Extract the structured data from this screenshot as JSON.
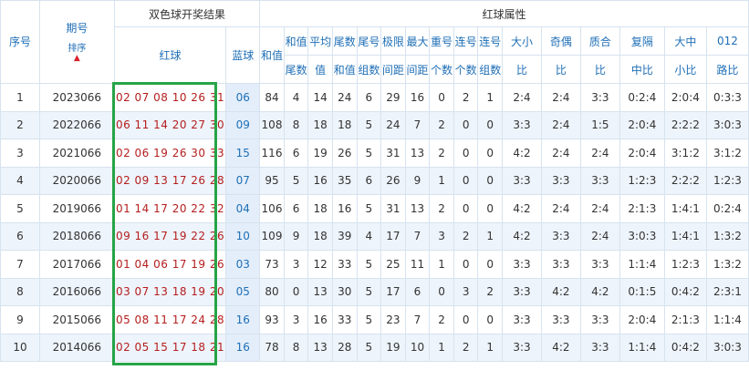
{
  "header": {
    "seq_label": "序号",
    "period_label": "期号",
    "sort_label": "排序",
    "sort_arrow": "▲",
    "draw_results_label": "双色球开奖结果",
    "red_ball_label": "红球",
    "blue_ball_label": "蓝球",
    "red_attr_label": "红球属性",
    "attr_columns": [
      {
        "line1": "和值",
        "line2": ""
      },
      {
        "line1": "和值",
        "line2": "尾数"
      },
      {
        "line1": "平均",
        "line2": "值"
      },
      {
        "line1": "尾数",
        "line2": "和值"
      },
      {
        "line1": "尾号",
        "line2": "组数"
      },
      {
        "line1": "极限",
        "line2": "间距"
      },
      {
        "line1": "最大",
        "line2": "间距"
      },
      {
        "line1": "重号",
        "line2": "个数"
      },
      {
        "line1": "连号",
        "line2": "个数"
      },
      {
        "line1": "连号",
        "line2": "组数"
      },
      {
        "line1": "大小",
        "line2": "比"
      },
      {
        "line1": "奇偶",
        "line2": "比"
      },
      {
        "line1": "质合",
        "line2": "比"
      },
      {
        "line1": "复隔",
        "line2": "中比"
      },
      {
        "line1": "大中",
        "line2": "小比"
      },
      {
        "line1": "012",
        "line2": "路比"
      }
    ]
  },
  "colors": {
    "header_text": "#1f6fb6",
    "red_ball_text": "#b41e1e",
    "highlight_border": "#26a447",
    "alt_row_bg": "#eef4fb"
  },
  "rows": [
    {
      "seq": "1",
      "period": "2023066",
      "red": "02 07 08 10 26 31",
      "blue": "06",
      "attrs": [
        "84",
        "4",
        "14",
        "24",
        "6",
        "29",
        "16",
        "0",
        "2",
        "1",
        "2:4",
        "2:4",
        "3:3",
        "0:2:4",
        "2:0:4",
        "0:3:3"
      ]
    },
    {
      "seq": "2",
      "period": "2022066",
      "red": "06 11 14 20 27 30",
      "blue": "09",
      "attrs": [
        "108",
        "8",
        "18",
        "18",
        "5",
        "24",
        "7",
        "2",
        "0",
        "0",
        "3:3",
        "2:4",
        "1:5",
        "2:0:4",
        "2:2:2",
        "3:0:3"
      ]
    },
    {
      "seq": "3",
      "period": "2021066",
      "red": "02 06 19 26 30 33",
      "blue": "15",
      "attrs": [
        "116",
        "6",
        "19",
        "26",
        "5",
        "31",
        "13",
        "2",
        "0",
        "0",
        "4:2",
        "2:4",
        "2:4",
        "2:0:4",
        "3:1:2",
        "3:1:2"
      ]
    },
    {
      "seq": "4",
      "period": "2020066",
      "red": "02 09 13 17 26 28",
      "blue": "07",
      "attrs": [
        "95",
        "5",
        "16",
        "35",
        "6",
        "26",
        "9",
        "1",
        "0",
        "0",
        "3:3",
        "3:3",
        "3:3",
        "1:2:3",
        "2:2:2",
        "1:2:3"
      ]
    },
    {
      "seq": "5",
      "period": "2019066",
      "red": "01 14 17 20 22 32",
      "blue": "04",
      "attrs": [
        "106",
        "6",
        "18",
        "16",
        "5",
        "31",
        "13",
        "2",
        "0",
        "0",
        "4:2",
        "2:4",
        "2:4",
        "2:1:3",
        "1:4:1",
        "0:2:4"
      ]
    },
    {
      "seq": "6",
      "period": "2018066",
      "red": "09 16 17 19 22 26",
      "blue": "10",
      "attrs": [
        "109",
        "9",
        "18",
        "39",
        "4",
        "17",
        "7",
        "3",
        "2",
        "1",
        "4:2",
        "3:3",
        "2:4",
        "3:0:3",
        "1:4:1",
        "1:3:2"
      ]
    },
    {
      "seq": "7",
      "period": "2017066",
      "red": "01 04 06 17 19 26",
      "blue": "03",
      "attrs": [
        "73",
        "3",
        "12",
        "33",
        "5",
        "25",
        "11",
        "1",
        "0",
        "0",
        "3:3",
        "3:3",
        "3:3",
        "1:1:4",
        "1:2:3",
        "1:3:2"
      ]
    },
    {
      "seq": "8",
      "period": "2016066",
      "red": "03 07 13 18 19 20",
      "blue": "05",
      "attrs": [
        "80",
        "0",
        "13",
        "30",
        "5",
        "17",
        "6",
        "0",
        "3",
        "2",
        "3:3",
        "4:2",
        "4:2",
        "0:1:5",
        "0:4:2",
        "2:3:1"
      ]
    },
    {
      "seq": "9",
      "period": "2015066",
      "red": "05 08 11 17 24 28",
      "blue": "16",
      "attrs": [
        "93",
        "3",
        "16",
        "33",
        "5",
        "23",
        "7",
        "2",
        "0",
        "0",
        "3:3",
        "3:3",
        "3:3",
        "2:0:4",
        "2:1:3",
        "1:1:4"
      ]
    },
    {
      "seq": "10",
      "period": "2014066",
      "red": "02 05 15 17 18 21",
      "blue": "16",
      "attrs": [
        "78",
        "8",
        "13",
        "28",
        "5",
        "19",
        "10",
        "1",
        "2",
        "1",
        "3:3",
        "4:2",
        "3:3",
        "1:1:4",
        "0:4:2",
        "3:0:3"
      ]
    }
  ]
}
